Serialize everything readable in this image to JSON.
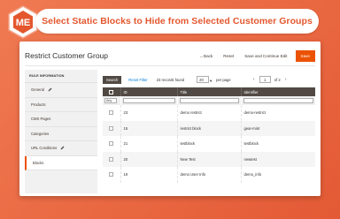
{
  "banner": {
    "title": "Select Static Blocks to Hide from Selected Customer Groups"
  },
  "page": {
    "title": "Restrict Customer Group"
  },
  "toolbar": {
    "back_label": "Back",
    "reset_label": "Reset",
    "save_continue_label": "Save and Continue Edit",
    "save_label": "Save"
  },
  "sidebar": {
    "heading": "RULE INFORMATION",
    "items": [
      {
        "label": "General",
        "editable": true
      },
      {
        "label": "Products",
        "editable": false
      },
      {
        "label": "CMS Pages",
        "editable": false
      },
      {
        "label": "Categories",
        "editable": false
      },
      {
        "label": "URL Conditions",
        "editable": true
      },
      {
        "label": "Blocks",
        "editable": false,
        "active": true
      }
    ]
  },
  "grid": {
    "search_label": "Search",
    "reset_filter_label": "Reset Filter",
    "records_found": "23 records found",
    "per_page_value": "20",
    "per_page_label": "per page",
    "current_page": "1",
    "page_of": "of 2",
    "columns": [
      "ID",
      "Title",
      "Identifier"
    ],
    "filter_select": "Any",
    "rows": [
      {
        "id": "23",
        "title": "demo restrict",
        "identifier": "demo-restrict"
      },
      {
        "id": "15",
        "title": "restrict block",
        "identifier": "gear-mint"
      },
      {
        "id": "21",
        "title": "testblock",
        "identifier": "testblock"
      },
      {
        "id": "20",
        "title": "New Test",
        "identifier": "newtest"
      },
      {
        "id": "19",
        "title": "demo User Info",
        "identifier": "demo_info"
      }
    ]
  },
  "colors": {
    "accent": "#eb5202",
    "background": "#ea6a44",
    "grid_header": "#514943"
  }
}
